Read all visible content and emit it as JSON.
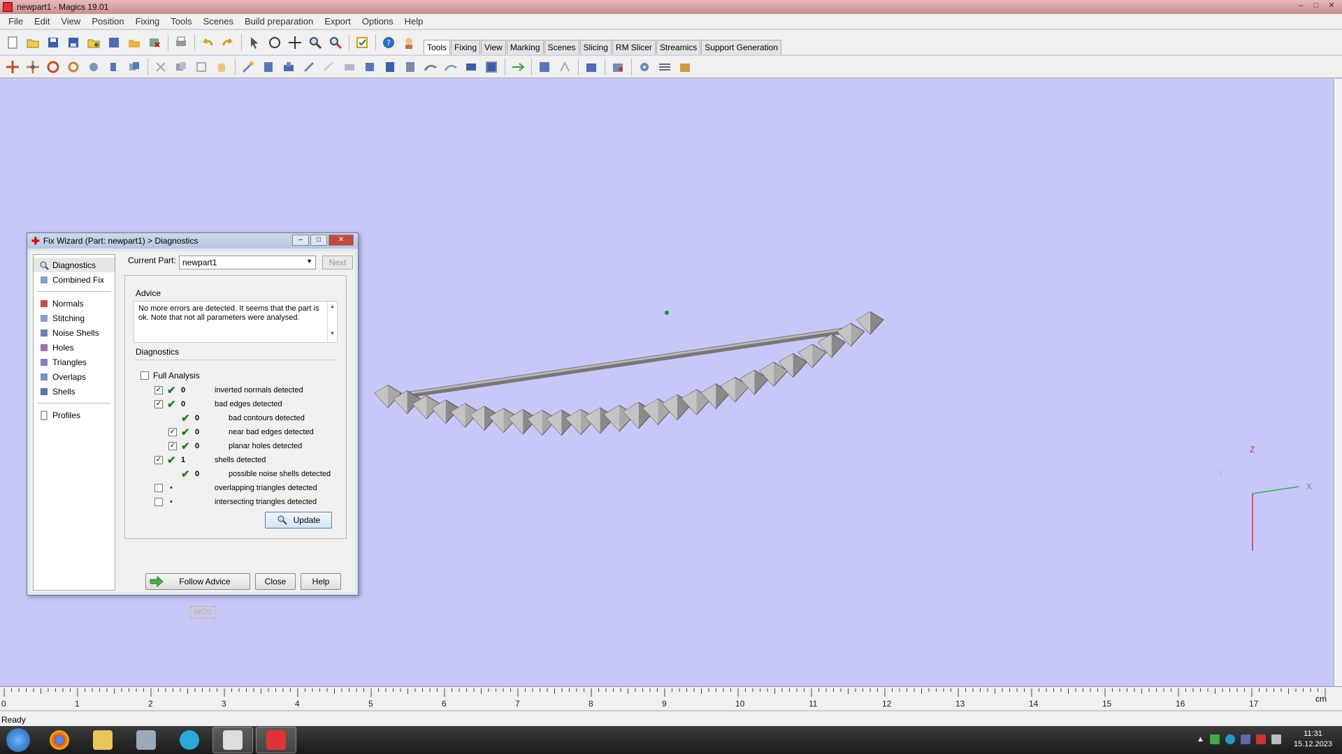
{
  "window": {
    "title": "newpart1 - Magics 19.01",
    "controls": [
      "–",
      "□",
      "✕"
    ]
  },
  "menu": [
    "File",
    "Edit",
    "View",
    "Position",
    "Fixing",
    "Tools",
    "Scenes",
    "Build preparation",
    "Export",
    "Options",
    "Help"
  ],
  "toolbar_tabs": [
    "Tools",
    "Fixing",
    "View",
    "Marking",
    "Scenes",
    "Slicing",
    "RM Slicer",
    "Streamics",
    "Support Generation"
  ],
  "active_tab": "Tools",
  "dialog": {
    "title": "Fix Wizard (Part: newpart1) > Diagnostics",
    "nav": [
      "Diagnostics",
      "Combined Fix",
      "Normals",
      "Stitching",
      "Noise Shells",
      "Holes",
      "Triangles",
      "Overlaps",
      "Shells",
      "Profiles"
    ],
    "current_part_label": "Current Part:",
    "current_part_value": "newpart1",
    "next_label": "Next",
    "advice_label": "Advice",
    "advice_text": "No more errors are detected. It seems that the part is ok. Note that not all parameters were analysed.",
    "diagnostics_label": "Diagnostics",
    "full_analysis_label": "Full Analysis",
    "rows": [
      {
        "count": "0",
        "text": "inverted normals detected"
      },
      {
        "count": "0",
        "text": "bad edges detected"
      },
      {
        "count": "0",
        "text": "bad contours detected"
      },
      {
        "count": "0",
        "text": "near bad edges detected"
      },
      {
        "count": "0",
        "text": "planar holes detected"
      },
      {
        "count": "1",
        "text": "shells detected"
      },
      {
        "count": "0",
        "text": "possible noise shells detected"
      },
      {
        "count": "",
        "text": "overlapping triangles detected"
      },
      {
        "count": "",
        "text": "intersecting triangles detected"
      }
    ],
    "update_label": "Update",
    "follow_advice_label": "Follow Advice",
    "close_label": "Close",
    "help_label": "Help"
  },
  "wcs_label": "WCS",
  "axes": {
    "z": "Z",
    "x": "X",
    "y": "Y"
  },
  "ruler": {
    "ticks": [
      "0",
      "1",
      "2",
      "3",
      "4",
      "5",
      "6",
      "7",
      "8",
      "9",
      "10",
      "11",
      "12",
      "13",
      "14",
      "15",
      "16",
      "17"
    ],
    "unit": "cm"
  },
  "status": "Ready",
  "clock": {
    "time": "11:31",
    "date": "15.12.2023"
  },
  "colors": {
    "viewport": "#c8c8f8",
    "check_green": "#1b7d1b",
    "axis_red": "#cc3344",
    "axis_green": "#33aa55"
  }
}
